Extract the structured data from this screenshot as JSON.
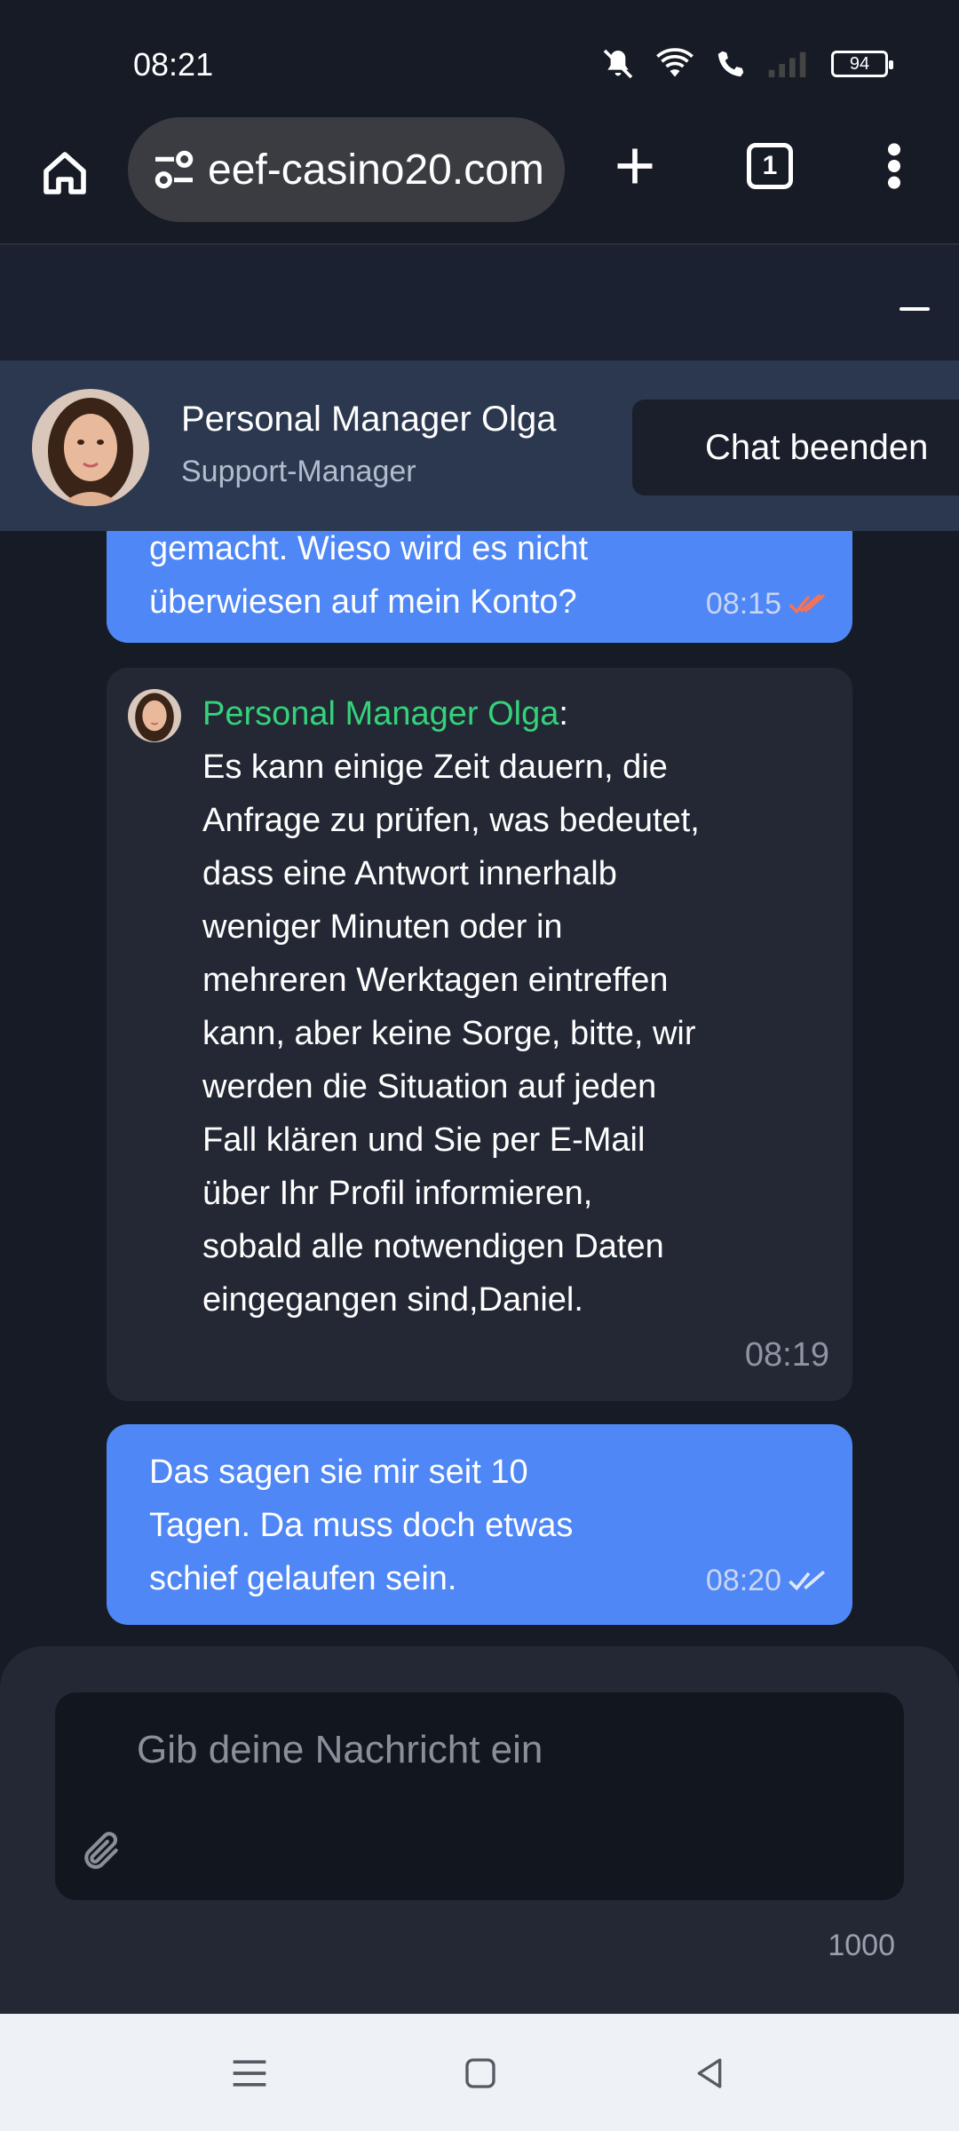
{
  "status_bar": {
    "time": "08:21",
    "battery": "94",
    "icons": [
      "mute-icon",
      "wifi-icon",
      "wifi-call-icon",
      "signal-icon",
      "battery-icon"
    ]
  },
  "browser": {
    "url": "eef-casino20.com",
    "tab_count": "1",
    "icons": [
      "home-icon",
      "site-settings-icon",
      "new-tab-icon",
      "tabs-icon",
      "more-menu-icon"
    ]
  },
  "chat_header": {
    "manager_name": "Personal Manager Olga",
    "manager_role": "Support-Manager",
    "end_chat_label": "Chat beenden"
  },
  "messages": [
    {
      "from": "user",
      "lines": [
        "gemacht. Wieso wird es nicht",
        "überwiesen auf mein Konto?"
      ],
      "time": "08:15",
      "read_color": "#f0735a"
    },
    {
      "from": "manager",
      "sender": "Personal Manager Olga",
      "text": "Es kann einige Zeit dauern, die Anfrage zu prüfen, was bedeutet, dass eine Antwort innerhalb weniger Minuten oder in mehreren Werktagen eintreffen kann, aber keine Sorge, bitte, wir werden die Situation auf jeden Fall klären und Sie per E-Mail über Ihr Profil informieren, sobald alle notwendigen Daten eingegangen sind,Daniel.",
      "time": "08:19"
    },
    {
      "from": "user",
      "lines": [
        "Das sagen sie mir seit 10",
        "Tagen. Da muss doch etwas",
        "schief gelaufen sein."
      ],
      "time": "08:20",
      "read_color": "#dfe8fb"
    }
  ],
  "composer": {
    "placeholder": "Gib deine Nachricht ein",
    "char_limit": "1000"
  },
  "colors": {
    "user_bubble": "#4f87f6",
    "manager_bubble": "#232834",
    "sender_name": "#35d27a",
    "header_bg": "#2c3850"
  }
}
